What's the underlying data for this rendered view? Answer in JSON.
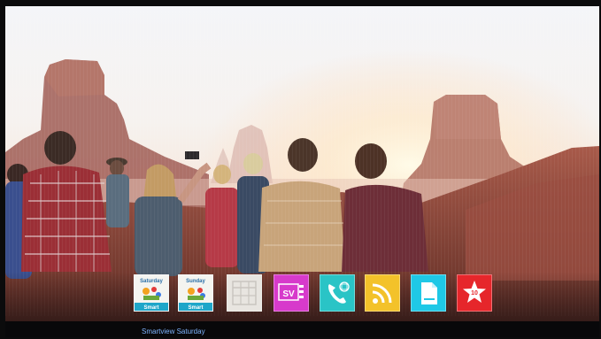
{
  "caption": "Smartview Saturday",
  "tiles": [
    {
      "icon": "smartview-saturday-icon",
      "top_text": "Saturday",
      "bottom_text": "Smart",
      "color": "#f2f2f2"
    },
    {
      "icon": "smartview-sunday-icon",
      "top_text": "Sunday",
      "bottom_text": "Smart",
      "color": "#f2f2f2"
    },
    {
      "icon": "guide-grid-icon",
      "color": "#e4e1dc"
    },
    {
      "icon": "sv-app-icon",
      "label": "SV",
      "color": "#d93ad0"
    },
    {
      "icon": "phone-call-icon",
      "color": "#29c6c7"
    },
    {
      "icon": "rss-feed-icon",
      "color": "#f3c32a"
    },
    {
      "icon": "document-icon",
      "color": "#20c9e6"
    },
    {
      "icon": "top10-star-icon",
      "label": "10",
      "color": "#e8262c"
    }
  ],
  "colors": {
    "caption": "#7fb4ff",
    "screen_bezel": "#0b0b0c"
  }
}
